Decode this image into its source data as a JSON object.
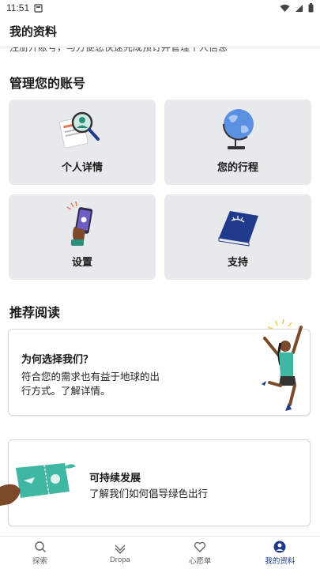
{
  "status_bar": {
    "time": "11:51"
  },
  "header": {
    "title": "我的资料"
  },
  "scrolled_text": "注册开账号，与方便您快速完成预订并管理个人信息",
  "manage": {
    "title": "管理您的账号",
    "cards": [
      {
        "label": "个人详情",
        "icon": "profile-magnifier-icon"
      },
      {
        "label": "您的行程",
        "icon": "globe-icon"
      },
      {
        "label": "设置",
        "icon": "phone-settings-icon"
      },
      {
        "label": "支持",
        "icon": "book-icon"
      }
    ]
  },
  "reading": {
    "title": "推荐阅读",
    "cards": [
      {
        "title": "为何选择我们？",
        "text_line1": "符合您的需求也有益于地球的出",
        "text_line2": "行方式。了解详情。"
      },
      {
        "title": "可持续发展",
        "text": "了解我们如何倡导绿色出行"
      }
    ]
  },
  "bottom_nav": {
    "items": [
      {
        "label": "探索",
        "icon": "search-icon"
      },
      {
        "label": "Dropa",
        "icon": "heart-outline-icon"
      },
      {
        "label": "心愿单",
        "icon": "heart-icon"
      },
      {
        "label": "我的资料",
        "icon": "profile-icon",
        "active": true
      }
    ]
  },
  "colors": {
    "accent": "#1f3a8a",
    "card_bg": "#e8e9ec",
    "teal": "#3fb7a3"
  }
}
